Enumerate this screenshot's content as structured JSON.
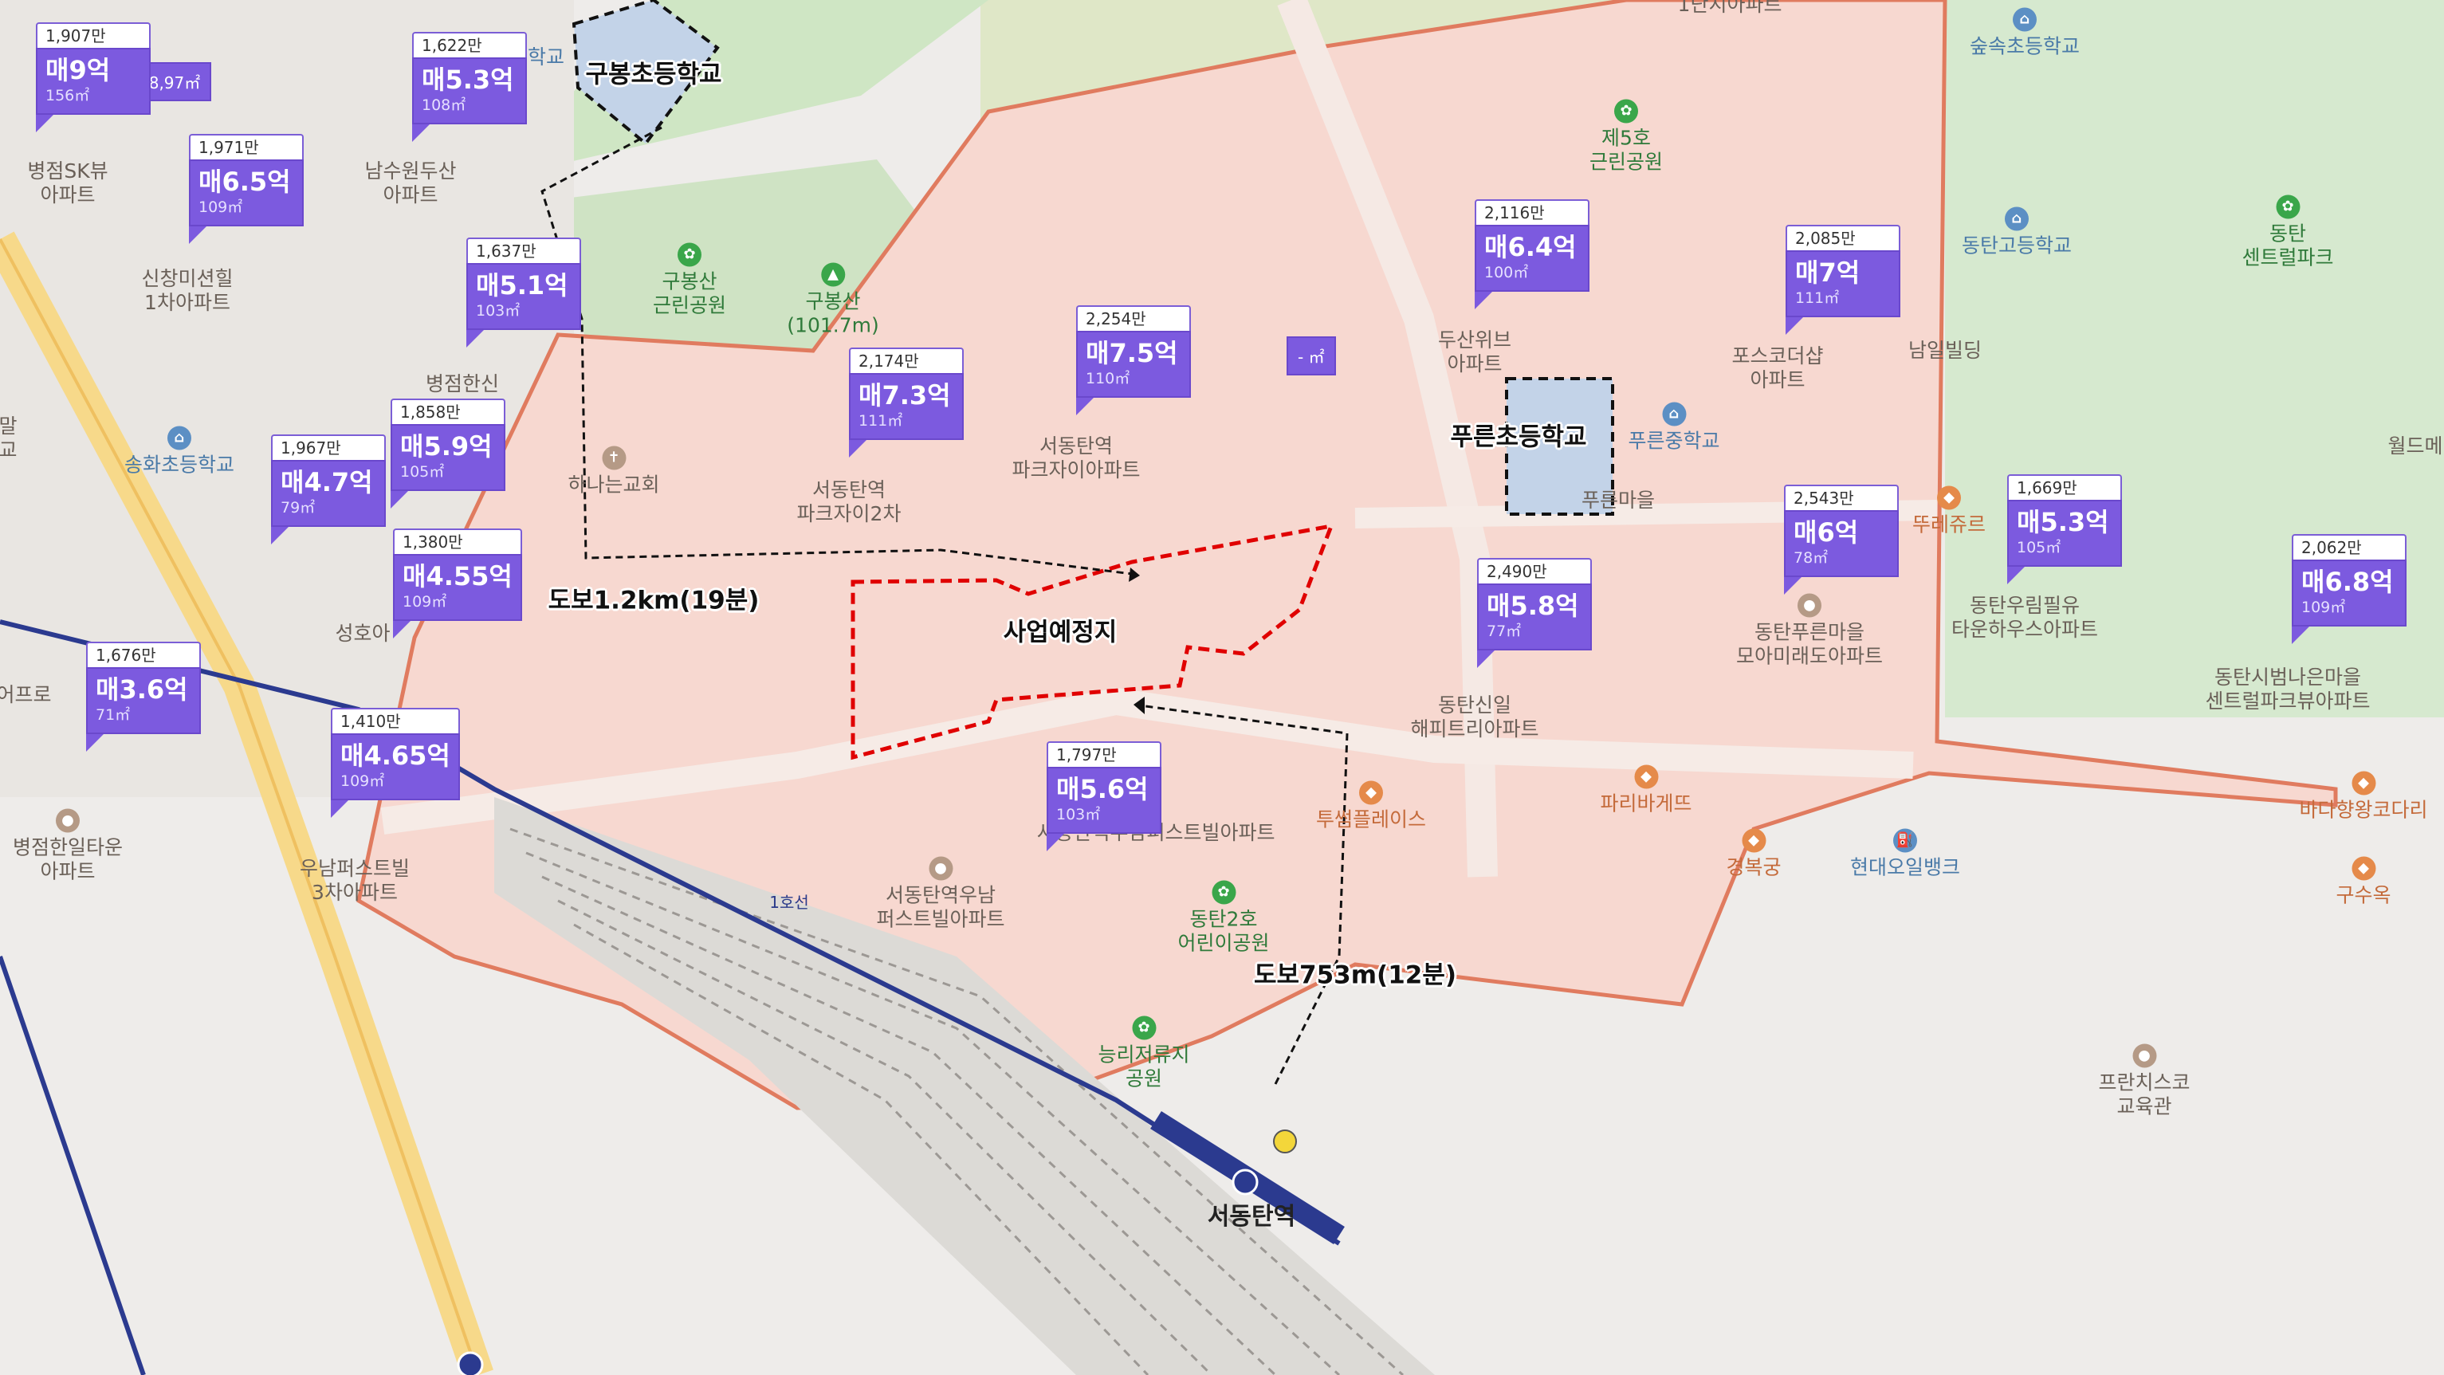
{
  "colors": {
    "complex_fill": "#f7d8d0",
    "complex_border": "#e07b5f",
    "site_border": "#e00000",
    "price_bubble": "#7c5adf",
    "line1": "#2b3a8f",
    "school_zone": "#c3d3e8",
    "park": "#c9e3c0"
  },
  "listings": [
    {
      "ppa": "1,907만",
      "price": "매9억",
      "area": "156㎡"
    },
    {
      "ppa": "1,622만",
      "price": "매5.3억",
      "area": "108㎡"
    },
    {
      "ppa": "1,971만",
      "price": "매6.5억",
      "area": "109㎡"
    },
    {
      "ppa": "1,637만",
      "price": "매5.1억",
      "area": "103㎡"
    },
    {
      "ppa": "2,254만",
      "price": "매7.5억",
      "area": "110㎡"
    },
    {
      "ppa": "2,174만",
      "price": "매7.3억",
      "area": "111㎡"
    },
    {
      "ppa": "1,858만",
      "price": "매5.9억",
      "area": "105㎡"
    },
    {
      "ppa": "1,967만",
      "price": "매4.7억",
      "area": "79㎡"
    },
    {
      "ppa": "1,380만",
      "price": "매4.55억",
      "area": "109㎡"
    },
    {
      "ppa": "1,676만",
      "price": "매3.6억",
      "area": "71㎡"
    },
    {
      "ppa": "1,410만",
      "price": "매4.65억",
      "area": "109㎡"
    },
    {
      "ppa": "1,797만",
      "price": "매5.6억",
      "area": "103㎡"
    },
    {
      "ppa": "2,116만",
      "price": "매6.4억",
      "area": "100㎡"
    },
    {
      "ppa": "2,085만",
      "price": "매7억",
      "area": "111㎡"
    },
    {
      "ppa": "2,490만",
      "price": "매5.8억",
      "area": "77㎡"
    },
    {
      "ppa": "2,543만",
      "price": "매6억",
      "area": "78㎡"
    },
    {
      "ppa": "1,669만",
      "price": "매5.3억",
      "area": "105㎡"
    },
    {
      "ppa": "2,062만",
      "price": "매6.8억",
      "area": "109㎡"
    }
  ],
  "mini_markers": [
    "78,97㎡",
    "- ㎡"
  ],
  "callouts": {
    "school_a": "구봉초등학교",
    "school_b": "푸른초등학교",
    "walk_a": "도보1.2km(19분)",
    "walk_b": "도보753m(12분)",
    "site": "사업예정지"
  },
  "places": {
    "skview": "병점SK뷰\n아파트",
    "namsu": "남수원두산\n아파트",
    "sinchang": "신창미션힐\n1차아파트",
    "gubongpark": "구봉산\n근린공원",
    "gubongsan": "구봉산\n(101.7m)",
    "songhwa": "송화초등학교",
    "byeongjeomhansin": "병점한신",
    "hananuri": "하나는교회",
    "seodongxi2": "서동탄역\n파크자이2차",
    "seodongxi": "서동탄역\n파크자이아파트",
    "seongho": "성호아",
    "hanil": "병점한일타운\n아파트",
    "woonam3": "우남퍼스트빌\n3차아파트",
    "seodongwoonam": "서동탄역우남\n퍼스트빌아파트",
    "fbill": "서동탄역우남퍼스트빌아파트",
    "park5": "제5호\n근린공원",
    "doosan": "두산위브\n아파트",
    "posco": "포스코더샵\n아파트",
    "sinil": "동탄신일\n해피트리아파트",
    "pureun_middle": "푸른중학교",
    "pureun_village": "푸른마을",
    "dongtan_high": "동탄고등학교",
    "namil": "남일빌딩",
    "suksok": "숲속초등학교",
    "central": "동탄\n센트럴파크",
    "moa": "동탄푸른마을\n모아미래도아파트",
    "urim": "동탄우림필유\n타운하우스아파트",
    "bumna": "동탄시범나은마을\n센트럴파크뷰아파트",
    "tousle": "뚜레쥬르",
    "paris": "파리바게뜨",
    "gyeongbok": "경복궁",
    "hyundai": "현대오일뱅크",
    "bada": "바다향왕코다리",
    "gusu": "구수옥",
    "francis": "프란치스코\n교육관",
    "dongtan2": "동탄2호\n어린이공원",
    "nuri": "능리저류지\n공원",
    "tosam": "투썸플레이스",
    "station": "서동탄역",
    "line": "1호선",
    "world": "월드메",
    "top1": "1단지아파트",
    "school_top": "학교",
    "farr": "어프로",
    "mal": "말\n교"
  }
}
